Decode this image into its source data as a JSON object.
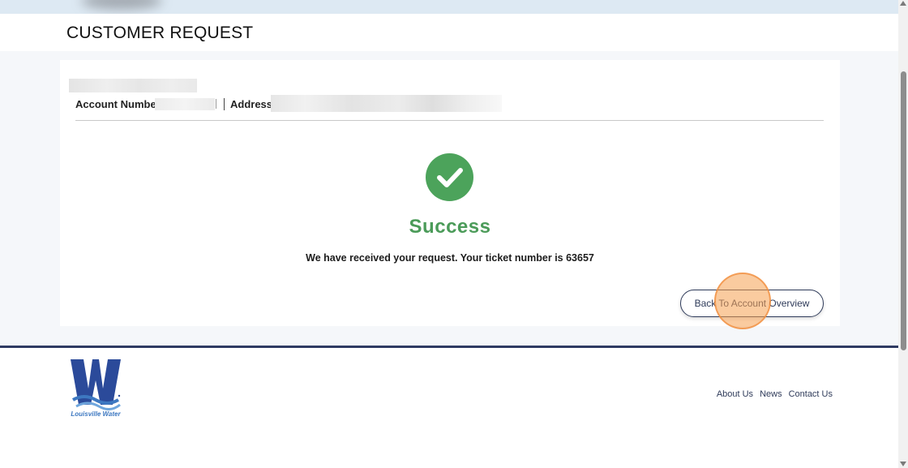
{
  "header": {
    "title": "CUSTOMER REQUEST"
  },
  "account": {
    "number_label": "Account Number",
    "address_label": "Address"
  },
  "result": {
    "status": "Success",
    "message": "We have received your request. Your ticket number is 63657",
    "icon": "check-icon",
    "status_color": "#4b9b59"
  },
  "actions": {
    "back_label": "Back To Account Overview"
  },
  "footer": {
    "logo_text": "Louisville Water",
    "links": [
      "About Us",
      "News",
      "Contact Us"
    ]
  },
  "colors": {
    "accent": "#2f3b5a",
    "success": "#4ca35b",
    "logo_blue": "#2b4a9a",
    "logo_wave": "#3d78c1"
  }
}
